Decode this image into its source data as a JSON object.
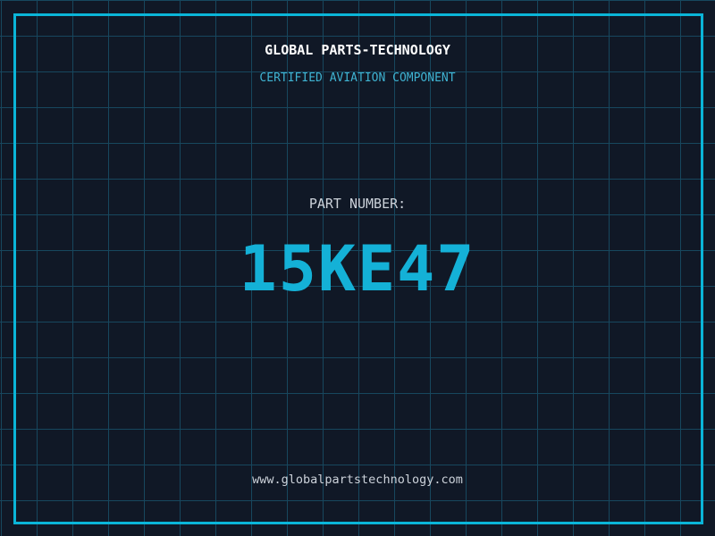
{
  "colors": {
    "background": "#101826",
    "grid_line": "#17475e",
    "frame_accent": "#0ab5d8",
    "subtitle_cyan": "#3fb3d2",
    "part_number_cyan": "#14b1d7",
    "label_gray": "#ccd2da",
    "title_white": "#ffffff"
  },
  "header": {
    "title": "GLOBAL PARTS-TECHNOLOGY",
    "subtitle": "CERTIFIED AVIATION COMPONENT"
  },
  "part": {
    "label": "PART NUMBER:",
    "number": "15KE47"
  },
  "footer": {
    "website": "www.globalpartstechnology.com"
  }
}
